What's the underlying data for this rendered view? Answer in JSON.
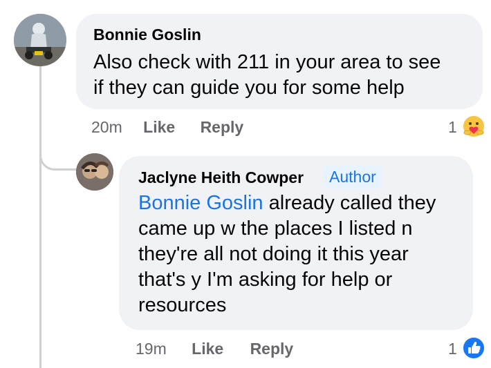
{
  "comments": [
    {
      "author": "Bonnie Goslin",
      "text_lines": [
        "Also check with 211 in your area to see",
        "if they can guide you for some help"
      ],
      "time": "20m",
      "like_label": "Like",
      "reply_label": "Reply",
      "reaction_count": "1",
      "reaction_icon": "care-reaction-icon"
    },
    {
      "author": "Jaclyne Heith Cowper",
      "badge": "Author",
      "mention": "Bonnie Goslin",
      "text_lines": [
        " already called they",
        "came up w the places I listed n",
        "they're all not doing it this year",
        "that's y I'm asking for help or",
        "resources"
      ],
      "time": "19m",
      "like_label": "Like",
      "reply_label": "Reply",
      "reaction_count": "1",
      "reaction_icon": "like-reaction-icon"
    }
  ],
  "colors": {
    "bubble": "#f0f2f5",
    "link": "#1b74e4",
    "meta": "#65676b",
    "like_blue": "#1877f2"
  }
}
